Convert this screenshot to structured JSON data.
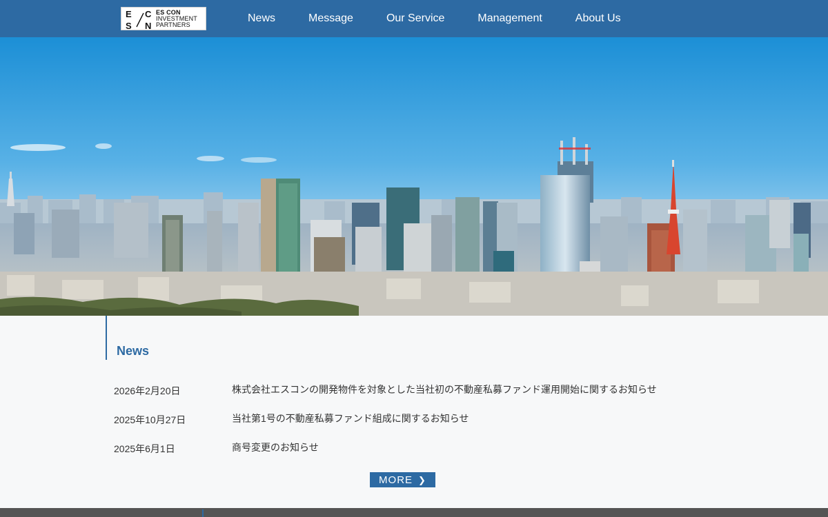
{
  "header": {
    "logo": {
      "mark_letters": [
        "E",
        "C",
        "S",
        "N"
      ],
      "lines": [
        "ES CON",
        "INVESTMENT",
        "PARTNERS"
      ]
    },
    "nav": [
      "News",
      "Message",
      "Our Service",
      "Management",
      "About Us"
    ]
  },
  "news": {
    "title": "News",
    "items": [
      {
        "date": "2026年2月20日",
        "text": "株式会社エスコンの開発物件を対象とした当社初の不動産私募ファンド運用開始に関するお知らせ"
      },
      {
        "date": "2025年10月27日",
        "text": "当社第1号の不動産私募ファンド組成に関するお知らせ"
      },
      {
        "date": "2025年6月1日",
        "text": "商号変更のお知らせ"
      }
    ],
    "more_label": "MORE"
  },
  "colors": {
    "brand": "#2d6aa3",
    "background": "#f7f8f9",
    "footer": "#555555"
  },
  "icons": {
    "more": "chevron-right-icon"
  }
}
